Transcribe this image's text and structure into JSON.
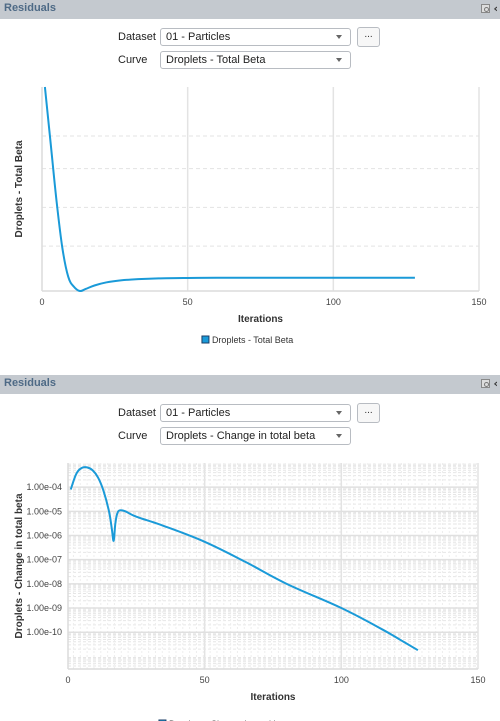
{
  "panels": [
    {
      "title": "Residuals",
      "dataset_label": "Dataset",
      "dataset_value": "01 - Particles",
      "curve_label": "Curve",
      "curve_value": "Droplets - Total Beta",
      "more_button": "...",
      "icons": [
        "restore-icon",
        "collapse-icon"
      ]
    },
    {
      "title": "Residuals",
      "dataset_label": "Dataset",
      "dataset_value": "01 - Particles",
      "curve_label": "Curve",
      "curve_value": "Droplets - Change in total beta",
      "more_button": "...",
      "icons": [
        "restore-icon",
        "collapse-icon"
      ]
    }
  ],
  "colors": {
    "series": "#1a9ad8",
    "header": "#c4c9cf",
    "title": "#4e6a86"
  },
  "chart_data": [
    {
      "type": "line",
      "title": "",
      "xlabel": "Iterations",
      "ylabel": "Droplets - Total Beta",
      "xlim": [
        0,
        150
      ],
      "xticks": [
        "0",
        "50",
        "100",
        "150"
      ],
      "yscale": "linear",
      "yticks_labels_shown": false,
      "ylim": [
        0,
        1
      ],
      "legend": {
        "position": "bottom",
        "entries": [
          "Droplets - Total Beta"
        ]
      },
      "grid": true,
      "series": [
        {
          "name": "Droplets - Total Beta",
          "x": [
            1,
            3,
            5,
            7,
            9,
            11,
            13,
            15,
            18,
            22,
            27,
            33,
            40,
            50,
            60,
            80,
            100,
            128
          ],
          "y": [
            1.0,
            0.72,
            0.44,
            0.21,
            0.07,
            0.02,
            0.0,
            0.01,
            0.027,
            0.042,
            0.052,
            0.058,
            0.062,
            0.064,
            0.065,
            0.065,
            0.065,
            0.065
          ]
        }
      ]
    },
    {
      "type": "line",
      "title": "",
      "xlabel": "Iterations",
      "ylabel": "Droplets - Change in total beta",
      "xlim": [
        0,
        150
      ],
      "xticks": [
        "0",
        "50",
        "100",
        "150"
      ],
      "yscale": "log",
      "ylim": [
        3e-12,
        0.001
      ],
      "yticks": [
        "1.00e-04",
        "1.00e-05",
        "1.00e-06",
        "1.00e-07",
        "1.00e-08",
        "1.00e-09",
        "1.00e-10"
      ],
      "legend": {
        "position": "bottom",
        "entries": [
          "Droplets - Change in total beta"
        ]
      },
      "grid": true,
      "series": [
        {
          "name": "Droplets - Change in total beta",
          "x": [
            1,
            3,
            5,
            7,
            9,
            11,
            13,
            15,
            16,
            16.7,
            17.3,
            18,
            19,
            21,
            25,
            35,
            50,
            65,
            80,
            100,
            115,
            122,
            128
          ],
          "y": [
            8e-05,
            0.00035,
            0.00062,
            0.00066,
            0.0005,
            0.00025,
            7e-05,
            1e-05,
            2e-06,
            6e-07,
            3e-06,
            8e-06,
            1.1e-05,
            1e-05,
            6e-06,
            2.5e-06,
            5.5e-07,
            8e-08,
            1e-08,
            1e-09,
            1.3e-10,
            4.5e-11,
            1.8e-11
          ]
        }
      ]
    }
  ]
}
